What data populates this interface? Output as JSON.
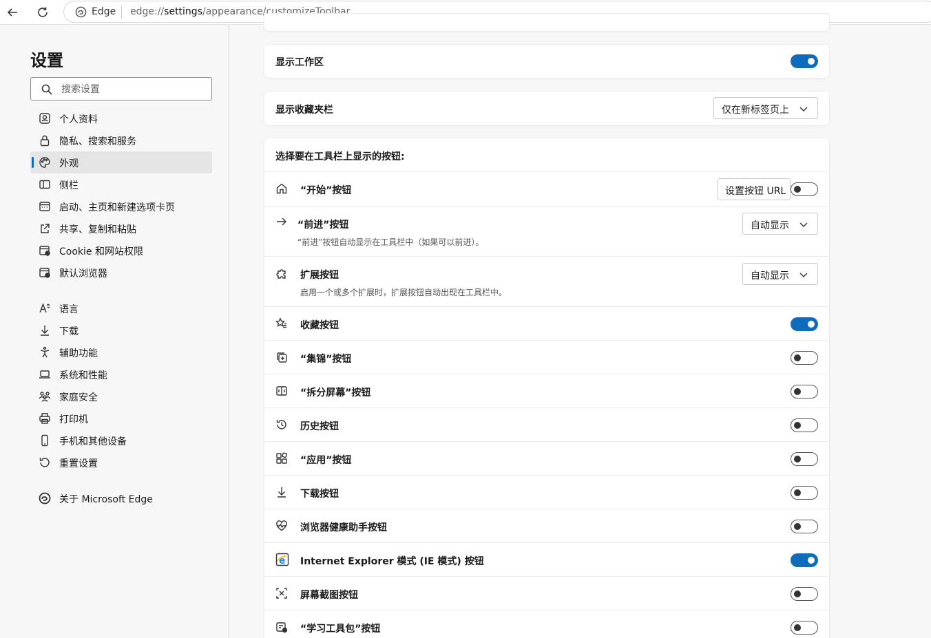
{
  "browser": {
    "site_label": "Edge",
    "url_prefix": "edge://",
    "url_host": "settings",
    "url_path": "/appearance/customizeToolbar"
  },
  "sidebar": {
    "title": "设置",
    "search_placeholder": "搜索设置",
    "items": [
      {
        "label": "个人资料",
        "icon": "profile-icon"
      },
      {
        "label": "隐私、搜索和服务",
        "icon": "lock-icon"
      },
      {
        "label": "外观",
        "icon": "palette-icon",
        "active": true
      },
      {
        "label": "侧栏",
        "icon": "sidebar-icon"
      },
      {
        "label": "启动、主页和新建选项卡页",
        "icon": "home-page-icon"
      },
      {
        "label": "共享、复制和粘贴",
        "icon": "share-icon"
      },
      {
        "label": "Cookie 和网站权限",
        "icon": "cookie-permissions-icon"
      },
      {
        "label": "默认浏览器",
        "icon": "default-browser-icon"
      },
      {
        "label": "语言",
        "icon": "language-icon"
      },
      {
        "label": "下载",
        "icon": "download-icon"
      },
      {
        "label": "辅助功能",
        "icon": "accessibility-icon"
      },
      {
        "label": "系统和性能",
        "icon": "laptop-icon"
      },
      {
        "label": "家庭安全",
        "icon": "family-icon"
      },
      {
        "label": "打印机",
        "icon": "printer-icon"
      },
      {
        "label": "手机和其他设备",
        "icon": "phone-icon"
      },
      {
        "label": "重置设置",
        "icon": "reset-icon"
      },
      {
        "label": "关于 Microsoft Edge",
        "icon": "edge-logo-icon"
      }
    ]
  },
  "main": {
    "workspaces": {
      "label": "显示工作区",
      "enabled": true
    },
    "favorites_bar": {
      "label": "显示收藏夹栏",
      "value": "仅在新标签页上"
    },
    "toolbar_section_title": "选择要在工具栏上显示的按钮:",
    "home": {
      "label": "“开始”按钮",
      "url_button": "设置按钮 URL",
      "enabled": false
    },
    "forward": {
      "label": "“前进”按钮",
      "value": "自动显示",
      "description": "“前进”按钮自动显示在工具栏中（如果可以前进）。"
    },
    "extensions": {
      "label": "扩展按钮",
      "value": "自动显示",
      "description": "启用一个或多个扩展时，扩展按钮自动出现在工具栏中。"
    },
    "toggles": [
      {
        "label": "收藏按钮",
        "enabled": true,
        "icon": "favorites-icon"
      },
      {
        "label": "“集锦”按钮",
        "enabled": false,
        "icon": "collections-icon"
      },
      {
        "label": "“拆分屏幕”按钮",
        "enabled": false,
        "icon": "split-screen-icon"
      },
      {
        "label": "历史按钮",
        "enabled": false,
        "icon": "history-icon"
      },
      {
        "label": "“应用”按钮",
        "enabled": false,
        "icon": "apps-icon"
      },
      {
        "label": "下载按钮",
        "enabled": false,
        "icon": "download-icon"
      },
      {
        "label": "浏览器健康助手按钮",
        "enabled": false,
        "icon": "browser-health-icon"
      },
      {
        "label": "Internet Explorer 模式 (IE 模式) 按钮",
        "enabled": true,
        "icon": "ie-mode-icon"
      },
      {
        "label": "屏幕截图按钮",
        "enabled": false,
        "icon": "screenshot-icon"
      },
      {
        "label": "“学习工具包”按钮",
        "enabled": false,
        "icon": "learning-toolkit-icon"
      }
    ]
  },
  "colors": {
    "accent": "#0f6cbd",
    "sidebar_bg": "#f7f7f7"
  }
}
